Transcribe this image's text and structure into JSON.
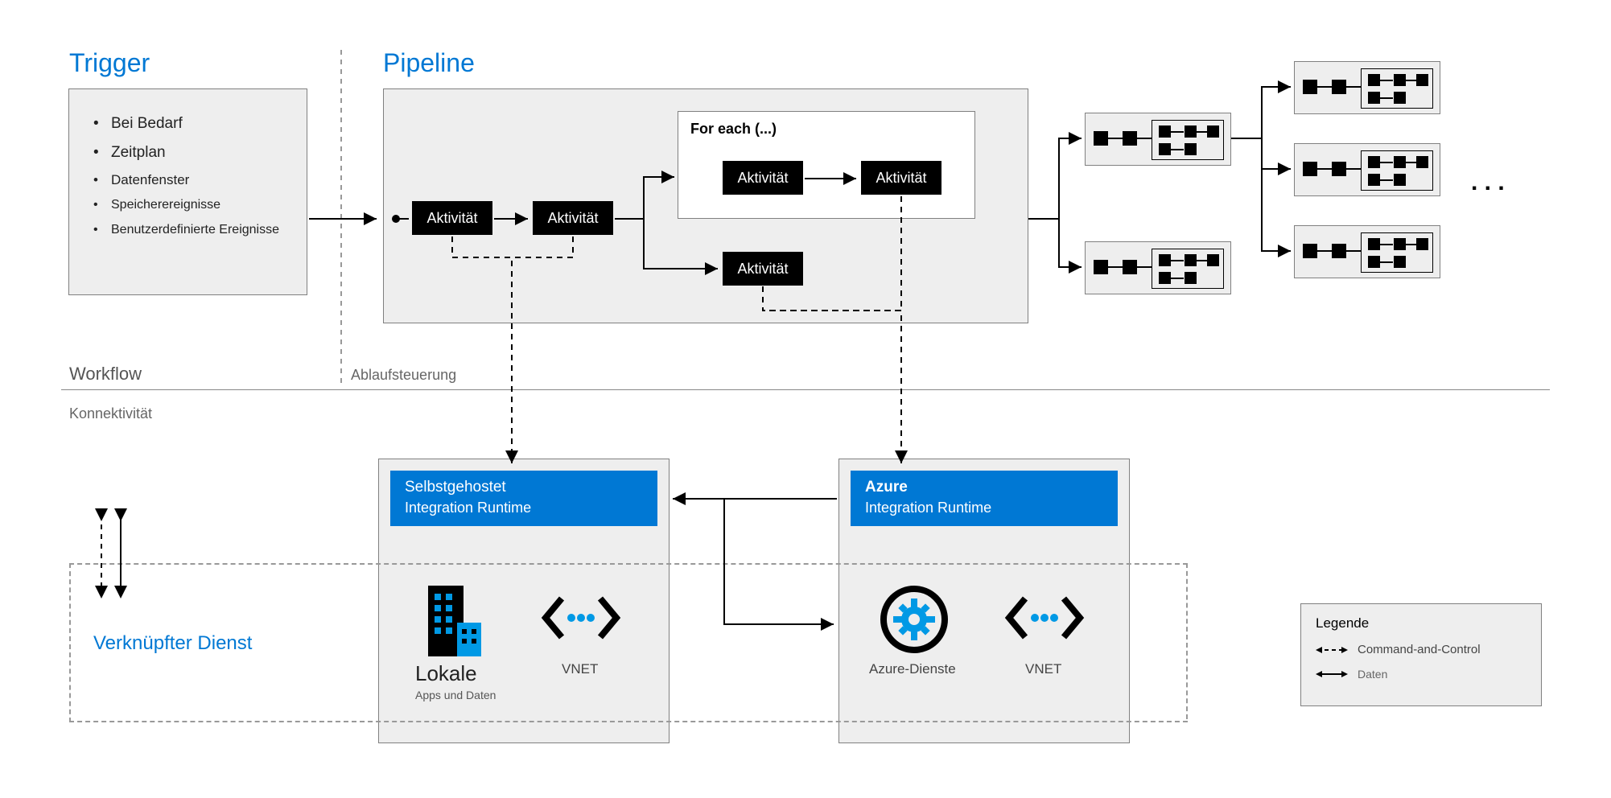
{
  "sections": {
    "trigger_title": "Trigger",
    "pipeline_title": "Pipeline",
    "workflow_label": "Workflow",
    "flowcontrol_label": "Ablaufsteuerung",
    "connectivity_label": "Konnektivität",
    "linked_service_title": "Verknüpfter Dienst",
    "ellipsis": ". . ."
  },
  "triggers": [
    "Bei Bedarf",
    "Zeitplan",
    "Datenfenster",
    "Speicherereignisse",
    "Benutzerdefinierte Ereignisse"
  ],
  "pipeline": {
    "activity_label": "Aktivität",
    "foreach_label": "For each (...)"
  },
  "runtimes": {
    "self_hosted": {
      "line1": "Selbstgehostet",
      "line2": "Integration Runtime",
      "icon1_top": "Lokale",
      "icon1_sub": "Apps und Daten",
      "icon2": "VNET"
    },
    "azure": {
      "line1": "Azure",
      "line2": "Integration Runtime",
      "icon1": "Azure-Dienste",
      "icon2": "VNET"
    }
  },
  "legend": {
    "title": "Legende",
    "row1": "Command-and-Control",
    "row2": "Daten"
  }
}
